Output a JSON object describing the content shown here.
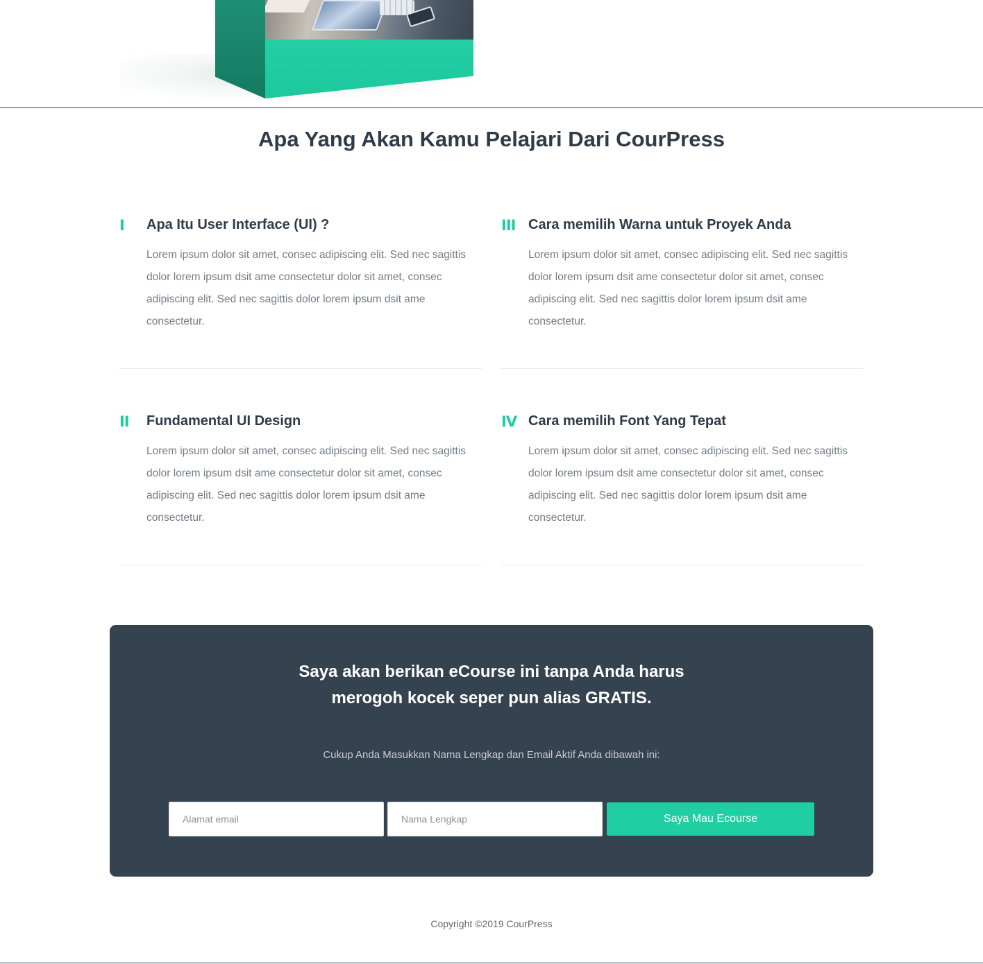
{
  "colors": {
    "accent": "#1fcfa1",
    "heading": "#2f3b48",
    "body_text": "#737c85",
    "cta_background": "#354250",
    "box_green": "#22cfa3"
  },
  "section": {
    "title": "Apa Yang Akan Kamu Pelajari Dari CourPress"
  },
  "lessons": [
    {
      "numeral": "I",
      "title": "Apa Itu User Interface (UI) ?",
      "description": "Lorem ipsum dolor sit amet, consec adipiscing elit. Sed nec sagittis dolor lorem ipsum dsit ame consectetur dolor sit amet, consec adipiscing elit. Sed nec sagittis dolor lorem ipsum dsit ame consectetur."
    },
    {
      "numeral": "II",
      "title": "Fundamental UI Design",
      "description": "Lorem ipsum dolor sit amet, consec adipiscing elit. Sed nec sagittis dolor lorem ipsum dsit ame consectetur dolor sit amet, consec adipiscing elit. Sed nec sagittis dolor lorem ipsum dsit ame consectetur."
    },
    {
      "numeral": "III",
      "title": "Cara memilih Warna untuk Proyek Anda",
      "description": "Lorem ipsum dolor sit amet, consec adipiscing elit. Sed nec sagittis dolor lorem ipsum dsit ame consectetur dolor sit amet, consec adipiscing elit. Sed nec sagittis dolor lorem ipsum dsit ame consectetur."
    },
    {
      "numeral": "IV",
      "title": "Cara memilih Font Yang Tepat",
      "description": "Lorem ipsum dolor sit amet, consec adipiscing elit. Sed nec sagittis dolor lorem ipsum dsit ame consectetur dolor sit amet, consec adipiscing elit. Sed nec sagittis dolor lorem ipsum dsit ame consectetur."
    }
  ],
  "cta": {
    "title_line1": "Saya akan berikan eCourse ini tanpa Anda harus",
    "title_line2": "merogoh kocek seper pun alias GRATIS.",
    "subtitle": "Cukup Anda Masukkan Nama Lengkap dan Email Aktif Anda dibawah ini:",
    "email_placeholder": "Alamat email",
    "name_placeholder": "Nama Lengkap",
    "button_label": "Saya Mau Ecourse"
  },
  "footer": {
    "copyright": "Copyright ©2019 CourPress"
  }
}
